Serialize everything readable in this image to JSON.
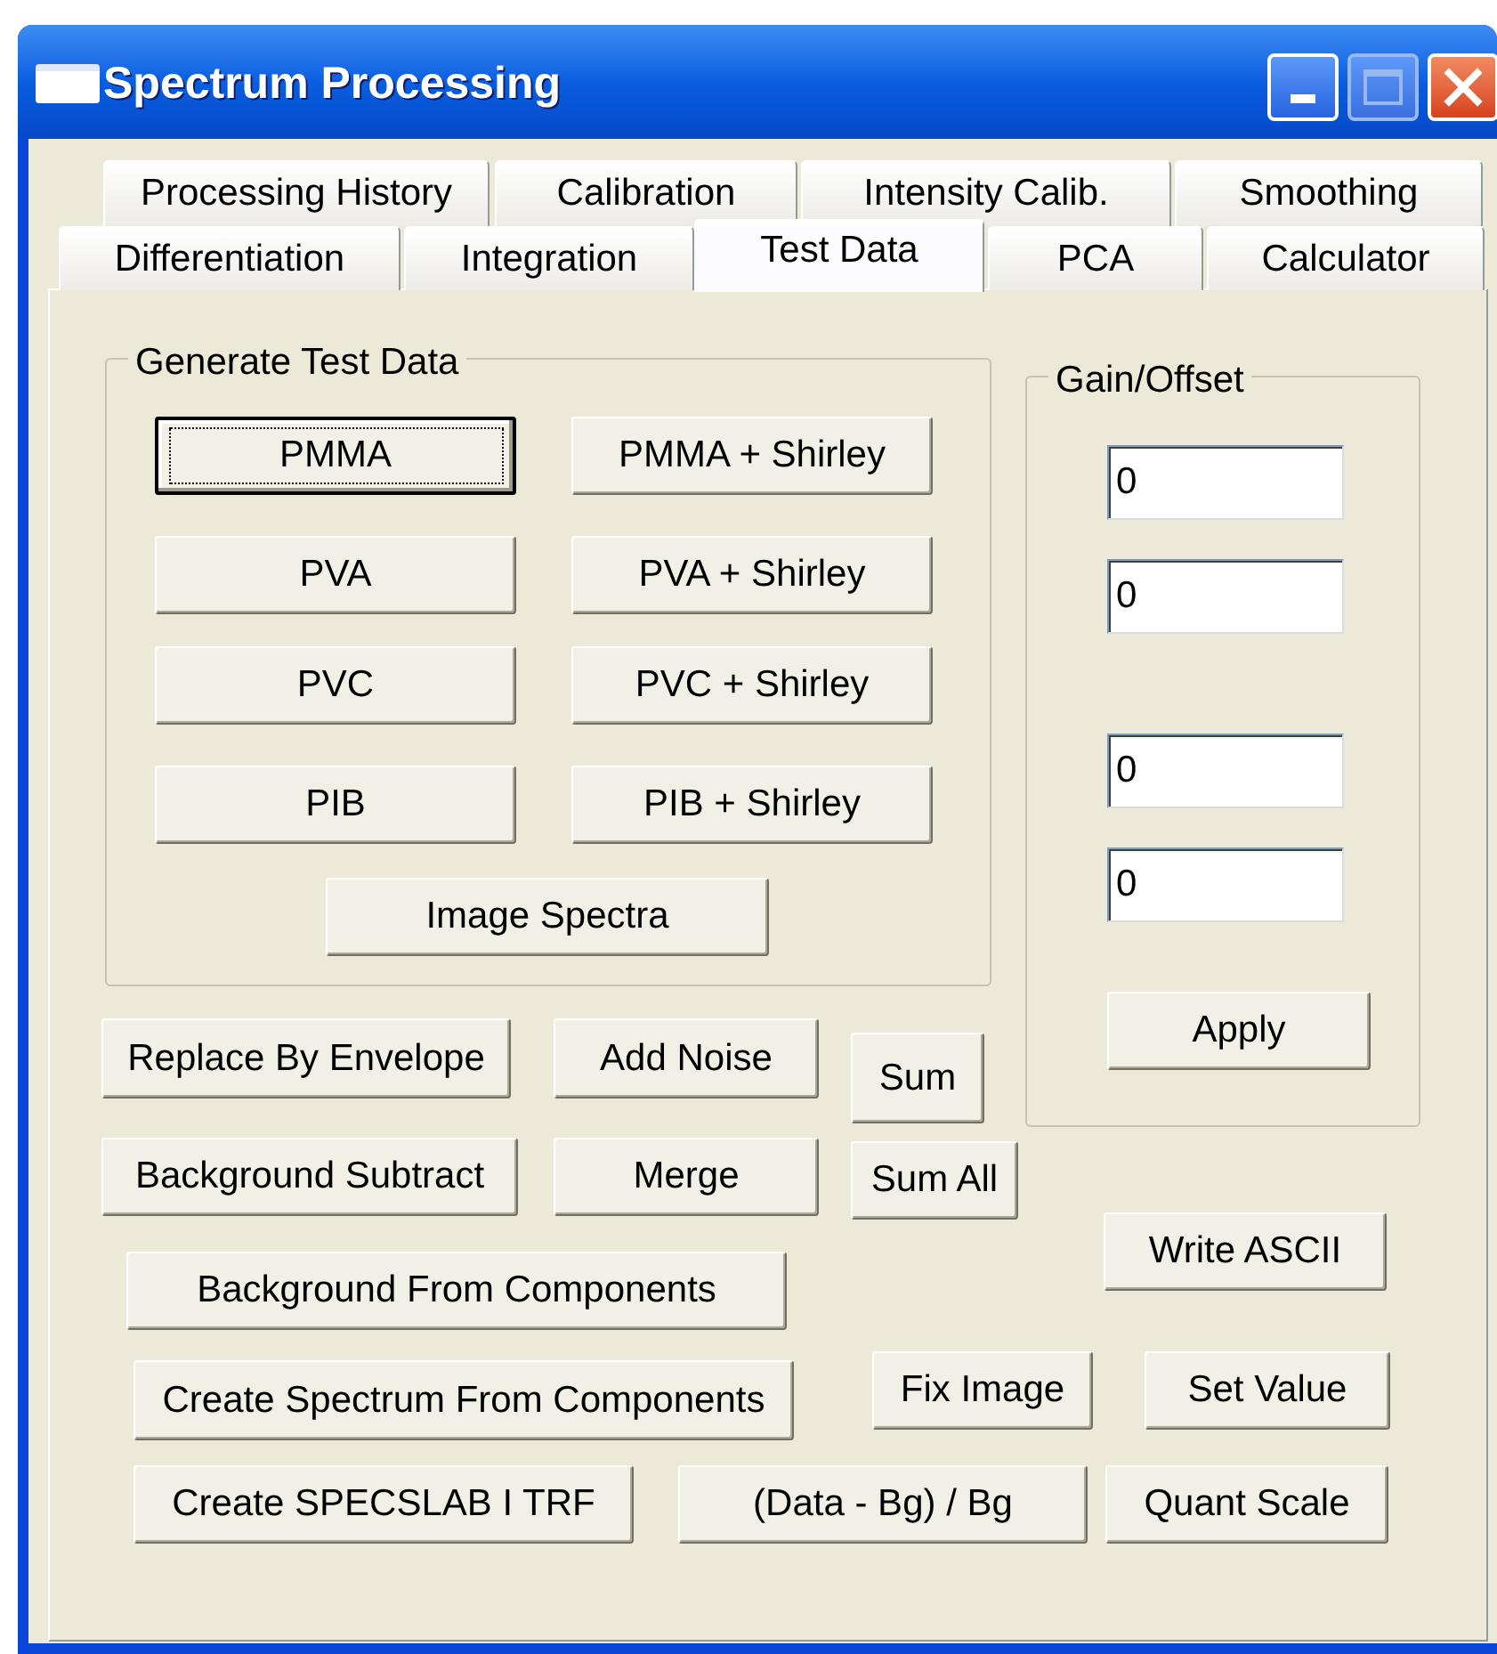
{
  "window": {
    "title": "Spectrum Processing"
  },
  "tab_rows": [
    [
      {
        "label": "Processing History",
        "selected": false
      },
      {
        "label": "Calibration",
        "selected": false
      },
      {
        "label": "Intensity Calib.",
        "selected": false
      },
      {
        "label": "Smoothing",
        "selected": false
      }
    ],
    [
      {
        "label": "Differentiation",
        "selected": false
      },
      {
        "label": "Integration",
        "selected": false
      },
      {
        "label": "Test Data",
        "selected": true
      },
      {
        "label": "PCA",
        "selected": false
      },
      {
        "label": "Calculator",
        "selected": false
      }
    ]
  ],
  "generate_group": {
    "label": "Generate Test Data",
    "buttons": [
      {
        "label": "PMMA",
        "focused": true
      },
      {
        "label": "PMMA + Shirley",
        "focused": false
      },
      {
        "label": "PVA",
        "focused": false
      },
      {
        "label": "PVA + Shirley",
        "focused": false
      },
      {
        "label": "PVC",
        "focused": false
      },
      {
        "label": "PVC + Shirley",
        "focused": false
      },
      {
        "label": "PIB",
        "focused": false
      },
      {
        "label": "PIB + Shirley",
        "focused": false
      },
      {
        "label": "Image Spectra",
        "focused": false
      }
    ]
  },
  "gain_offset": {
    "label": "Gain/Offset",
    "fields": [
      {
        "value": "0"
      },
      {
        "value": "0"
      },
      {
        "value": "0"
      },
      {
        "value": "0"
      }
    ],
    "apply": "Apply"
  },
  "buttons": [
    "Replace By Envelope",
    "Add Noise",
    "Sum",
    "Background Subtract",
    "Merge",
    "Sum All",
    "Write ASCII",
    "Background From Components",
    "Create Spectrum From Components",
    "Fix Image",
    "Set Value",
    "Create SPECSLAB I TRF",
    "(Data - Bg) / Bg",
    "Quant Scale"
  ]
}
